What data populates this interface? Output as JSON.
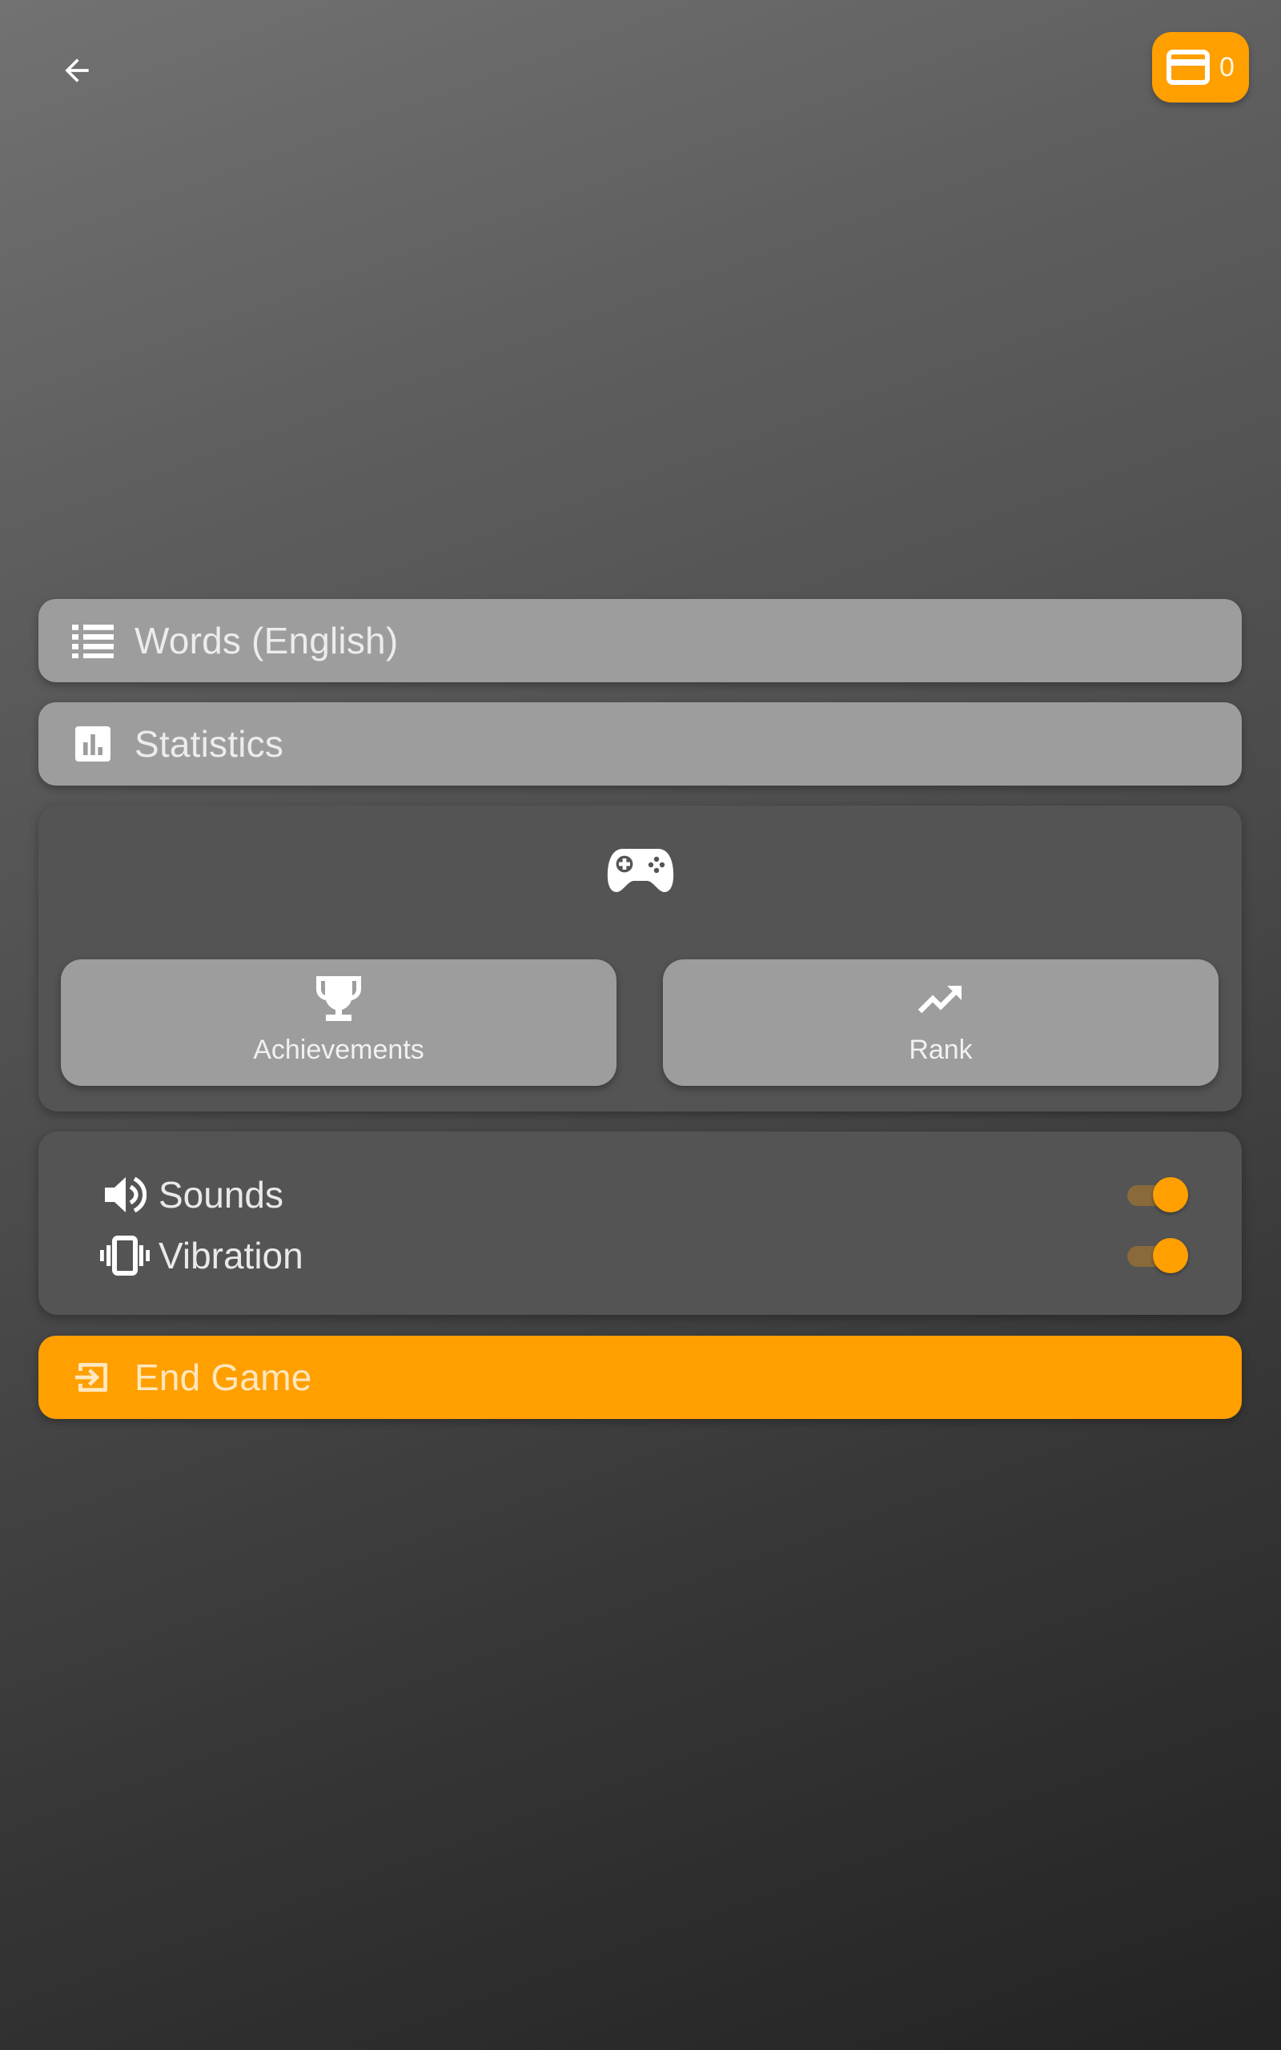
{
  "header": {
    "back_icon": "arrow-back-icon",
    "wallet": {
      "icon": "credit-card-icon",
      "count": "0"
    }
  },
  "menu": {
    "words": {
      "label": "Words (English)",
      "icon": "list-icon"
    },
    "statistics": {
      "label": "Statistics",
      "icon": "bar-chart-icon"
    }
  },
  "games_panel": {
    "icon": "gamepad-icon",
    "achievements": {
      "label": "Achievements",
      "icon": "trophy-icon"
    },
    "rank": {
      "label": "Rank",
      "icon": "trending-up-icon"
    }
  },
  "settings": {
    "sounds": {
      "label": "Sounds",
      "icon": "speaker-icon",
      "enabled": true
    },
    "vibration": {
      "label": "Vibration",
      "icon": "vibration-icon",
      "enabled": true
    }
  },
  "end_game": {
    "label": "End Game",
    "icon": "exit-icon"
  },
  "colors": {
    "accent": "#ff9f00",
    "row_background": "#9d9d9d",
    "panel_background": "#545454"
  }
}
